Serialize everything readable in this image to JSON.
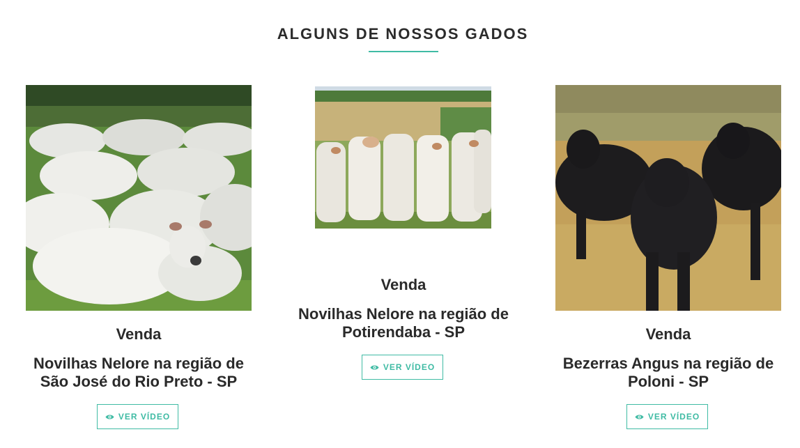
{
  "section": {
    "title": "ALGUNS DE NOSSOS GADOS",
    "accent_color": "#3fbba4"
  },
  "cards": [
    {
      "photo": "white-nelore-herd-photo",
      "type": "Venda",
      "title": "Novilhas Nelore na região de São José do Rio Preto - SP",
      "button_icon": "eye-icon",
      "button_label": "VER VÍDEO"
    },
    {
      "photo": "nelore-heifers-pasture-photo",
      "type": "Venda",
      "title": "Novilhas Nelore na região de Potirendaba - SP",
      "button_icon": "eye-icon",
      "button_label": "VER VÍDEO"
    },
    {
      "photo": "black-angus-calves-photo",
      "type": "Venda",
      "title": "Bezerras Angus na região de Poloni - SP",
      "button_icon": "eye-icon",
      "button_label": "VER VÍDEO"
    }
  ]
}
